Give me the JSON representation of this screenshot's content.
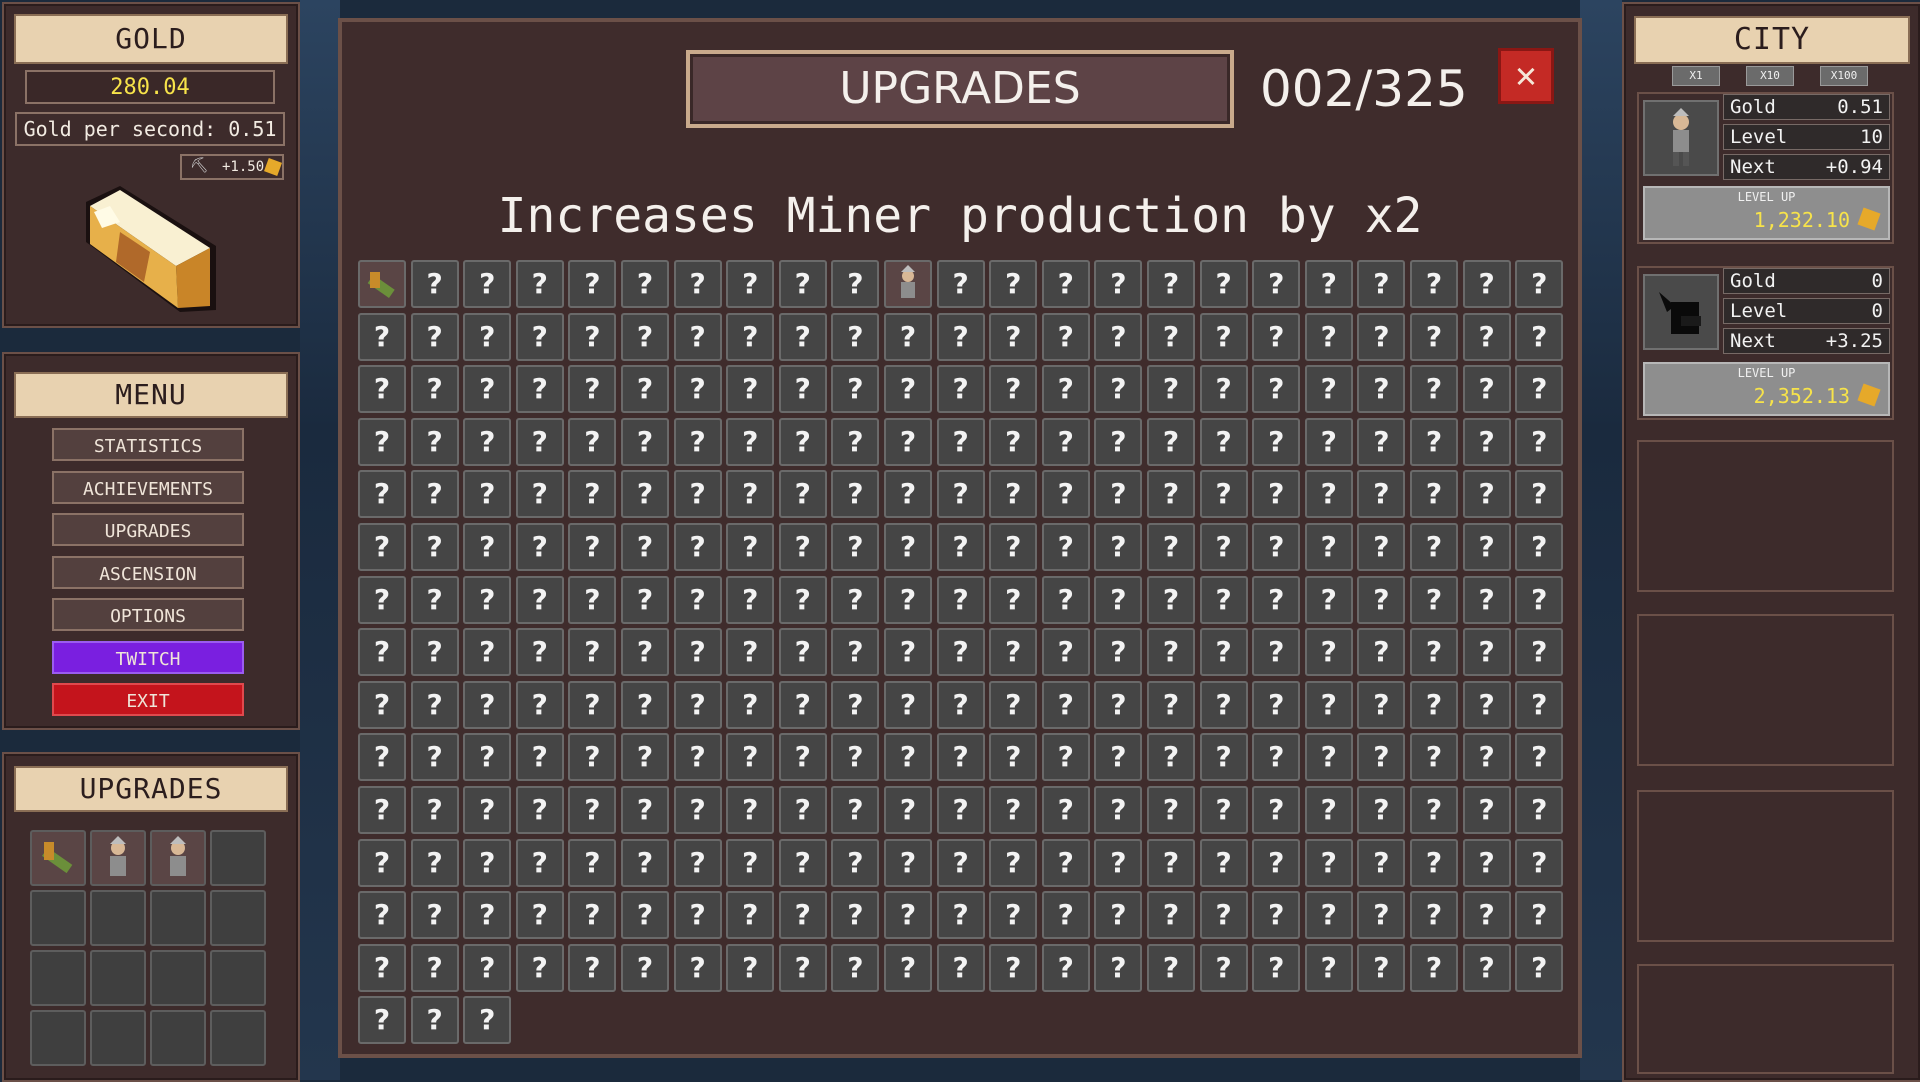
{
  "left": {
    "gold_title": "GOLD",
    "gold_value": "280.04",
    "gold_per_second": "Gold per second: 0.51",
    "click_bonus": "+1.50",
    "menu_title": "MENU",
    "menu": [
      "STATISTICS",
      "ACHIEVEMENTS",
      "UPGRADES",
      "ASCENSION",
      "OPTIONS",
      "TWITCH",
      "EXIT"
    ],
    "upgrades_title": "UPGRADES",
    "owned_upgrade_icons": [
      "hammer-icon",
      "miner-icon",
      "miner-icon"
    ]
  },
  "modal": {
    "title": "UPGRADES",
    "counter": "002/325",
    "description": "Increases Miner production by x2",
    "total_cells": 325,
    "owned_cells": [
      0,
      10
    ],
    "unknown_glyph": "?"
  },
  "city": {
    "title": "CITY",
    "multipliers": [
      "X1",
      "X10",
      "X100"
    ],
    "buildings": [
      {
        "gold_label": "Gold",
        "gold": "0.51",
        "level_label": "Level",
        "level": "10",
        "next_label": "Next",
        "next": "+0.94",
        "levelup_label": "LEVEL UP",
        "cost": "1,232.10",
        "icon": "miner-icon"
      },
      {
        "gold_label": "Gold",
        "gold": "0",
        "level_label": "Level",
        "level": "0",
        "next_label": "Next",
        "next": "+3.25",
        "levelup_label": "LEVEL UP",
        "cost": "2,352.13",
        "icon": "locked-silhouette-icon"
      }
    ]
  },
  "colors": {
    "panel": "#3d2b2b",
    "tan": "#e8d2b0",
    "gold_text": "#f7e34a",
    "twitch": "#7a1fe0",
    "exit": "#c4141c",
    "close": "#c42a25"
  }
}
